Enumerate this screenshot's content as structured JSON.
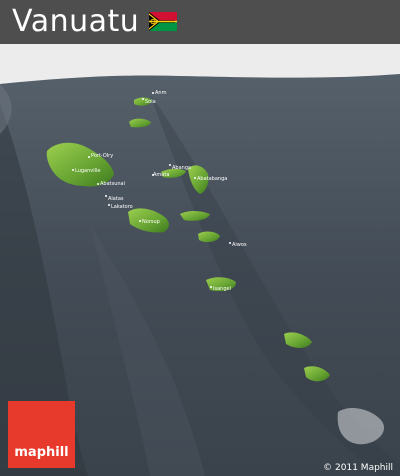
{
  "header": {
    "title": "Vanuatu",
    "flag_icon": "vanuatu-flag-icon"
  },
  "map": {
    "style": "3D relief, shaded dark sea",
    "colors": {
      "sea": "#3e4650",
      "sea_dark": "#2f363e",
      "land": "#5e9a2e",
      "land_light": "#8cc63f",
      "sky": "#ececec"
    },
    "places": [
      {
        "id": "aneityum-islet",
        "label": "Anm"
      },
      {
        "id": "sola",
        "label": "Sola"
      },
      {
        "id": "port-olry",
        "label": "Port-Olry"
      },
      {
        "id": "luganville",
        "label": "Luganville"
      },
      {
        "id": "abatsunai",
        "label": "Abatsunai"
      },
      {
        "id": "alatas",
        "label": "Alatas"
      },
      {
        "id": "lakatoro",
        "label": "Lakatoro"
      },
      {
        "id": "norsup",
        "label": "Norsup"
      },
      {
        "id": "abanga",
        "label": "Abanga"
      },
      {
        "id": "amata",
        "label": "Amata"
      },
      {
        "id": "abatabanga",
        "label": "Abatabanga"
      },
      {
        "id": "aiwos",
        "label": "Aiwos"
      },
      {
        "id": "isangel",
        "label": "Isangel"
      }
    ]
  },
  "brand": {
    "logo_text": "maphill",
    "copyright": "© 2011 Maphill",
    "accent": "#e83a2c"
  }
}
